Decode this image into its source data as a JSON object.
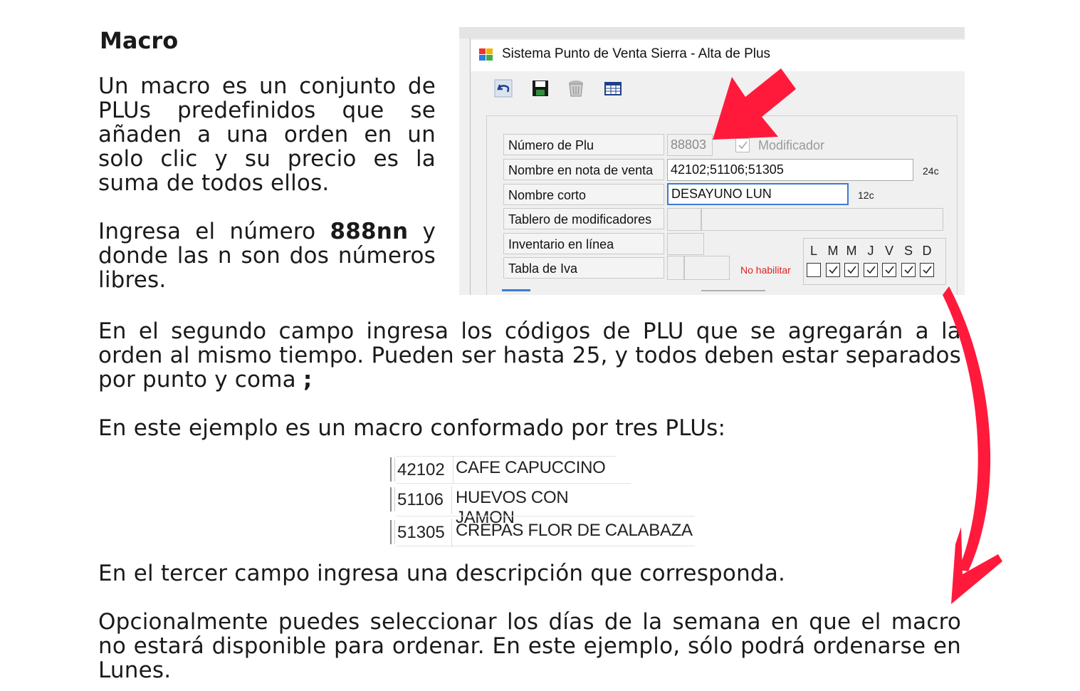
{
  "doc": {
    "title": "Macro",
    "intro": "Un macro es un conjunto de PLUs predefinidos que se añaden a una orden en un solo clic y su precio es la suma de todos ellos.",
    "number_prefix": "Ingresa el número ",
    "number_bold": "888nn",
    "number_suffix": " y donde las n son dos números libres.",
    "second_field_text": "En el segundo campo ingresa los códigos de PLU que se agregarán a la orden al mismo tiempo. Pueden ser hasta 25, y todos deben estar separados por punto y coma ",
    "second_field_bold": ";",
    "example_intro": "En este ejemplo es un macro conformado por tres PLUs:",
    "third_field_text": "En el tercer campo ingresa una descripción que corresponda.",
    "optional_text": "Opcionalmente puedes seleccionar los días de la semana en que el macro no estará disponible para ordenar. En este ejemplo, sólo podrá ordenarse en Lunes."
  },
  "window": {
    "title": "Sistema Punto de Venta Sierra  -  Alta de Plus",
    "labels": {
      "numero_plu": "Número de Plu",
      "nombre_nota": "Nombre en nota de venta",
      "nombre_corto": "Nombre corto",
      "tablero": "Tablero de modificadores",
      "inventario": "Inventario en línea",
      "tabla_iva": "Tabla de Iva"
    },
    "values": {
      "numero_plu": "88803",
      "nombre_nota": "42102;51106;51305",
      "nombre_corto": "DESAYUNO LUN"
    },
    "modificador_label": "Modificador",
    "nombre_nota_limit": "24c",
    "nombre_corto_limit": "12c",
    "no_habilitar": "No habilitar",
    "days": [
      {
        "letter": "L",
        "checked": false
      },
      {
        "letter": "M",
        "checked": true
      },
      {
        "letter": "M",
        "checked": true
      },
      {
        "letter": "J",
        "checked": true
      },
      {
        "letter": "V",
        "checked": true
      },
      {
        "letter": "S",
        "checked": true
      },
      {
        "letter": "D",
        "checked": true
      }
    ]
  },
  "plu_table": [
    {
      "code": "42102",
      "name": "CAFE CAPUCCINO"
    },
    {
      "code": "51106",
      "name": "HUEVOS CON JAMON"
    },
    {
      "code": "51305",
      "name": "CREPAS FLOR DE CALABAZA"
    }
  ],
  "colors": {
    "arrow": "#ff1a3c",
    "no_habilitar": "#e02020",
    "focus_border": "#3d7bd1"
  }
}
